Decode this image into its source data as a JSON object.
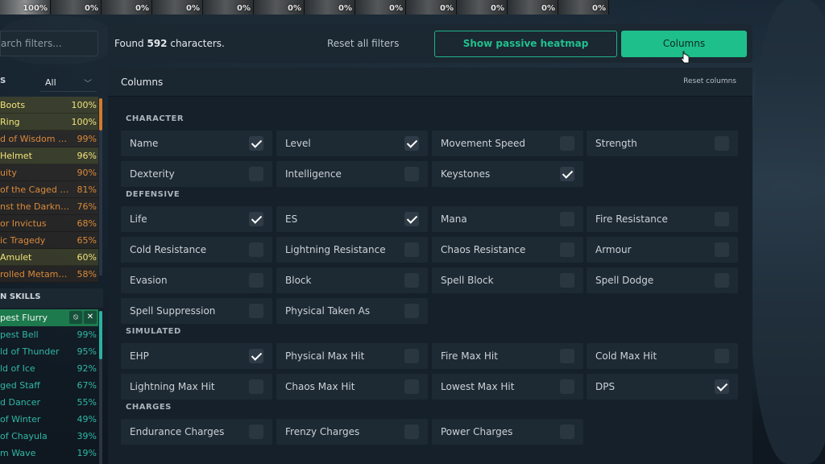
{
  "portraits": [
    "100%",
    "0%",
    "0%",
    "0%",
    "0%",
    "0%",
    "0%",
    "0%",
    "0%",
    "0%",
    "0%",
    "0%"
  ],
  "sidebar": {
    "search_placeholder": "arch filters...",
    "slot_label": "S",
    "slot_select": "All",
    "items": [
      {
        "name": "Boots",
        "pct": "100%",
        "color": "#f0e27a"
      },
      {
        "name": "Ring",
        "pct": "100%",
        "color": "#f0e27a"
      },
      {
        "name": "d of Wisdom and ...",
        "pct": "99%",
        "color": "#d98a3a"
      },
      {
        "name": "Helmet",
        "pct": "96%",
        "color": "#f0e27a"
      },
      {
        "name": "uity",
        "pct": "90%",
        "color": "#d98a3a"
      },
      {
        "name": "of the Caged God",
        "pct": "81%",
        "color": "#d98a3a"
      },
      {
        "name": "nst the Darkness",
        "pct": "76%",
        "color": "#d98a3a"
      },
      {
        "name": "or Invictus",
        "pct": "68%",
        "color": "#d98a3a"
      },
      {
        "name": "ic Tragedy",
        "pct": "65%",
        "color": "#d98a3a"
      },
      {
        "name": "Amulet",
        "pct": "60%",
        "color": "#f0e27a"
      },
      {
        "name": "rolled Metamorp...",
        "pct": "58%",
        "color": "#d98a3a"
      }
    ],
    "skills_heading": "N SKILLS",
    "skills": [
      {
        "name": "pest Flurry",
        "pct": "",
        "active": true
      },
      {
        "name": "pest Bell",
        "pct": "99%"
      },
      {
        "name": "ld of Thunder",
        "pct": "95%"
      },
      {
        "name": "ld of Ice",
        "pct": "92%"
      },
      {
        "name": "ged Staff",
        "pct": "67%"
      },
      {
        "name": "d Dancer",
        "pct": "55%"
      },
      {
        "name": "of Winter",
        "pct": "49%"
      },
      {
        "name": "of Chayula",
        "pct": "39%"
      },
      {
        "name": "m Wave",
        "pct": "19%"
      }
    ]
  },
  "topbar": {
    "found_prefix": "Found ",
    "found_count": "592",
    "found_suffix": " characters.",
    "reset_all": "Reset all filters",
    "heatmap_button": "Show passive heatmap",
    "columns_button": "Columns"
  },
  "panel": {
    "title": "Columns",
    "reset_columns": "Reset columns",
    "sections": [
      {
        "label": "CHARACTER",
        "options": [
          {
            "name": "Name",
            "checked": true
          },
          {
            "name": "Level",
            "checked": true
          },
          {
            "name": "Movement Speed",
            "checked": false
          },
          {
            "name": "Strength",
            "checked": false
          },
          {
            "name": "Dexterity",
            "checked": false
          },
          {
            "name": "Intelligence",
            "checked": false
          },
          {
            "name": "Keystones",
            "checked": true
          }
        ]
      },
      {
        "label": "DEFENSIVE",
        "options": [
          {
            "name": "Life",
            "checked": true
          },
          {
            "name": "ES",
            "checked": true
          },
          {
            "name": "Mana",
            "checked": false
          },
          {
            "name": "Fire Resistance",
            "checked": false
          },
          {
            "name": "Cold Resistance",
            "checked": false
          },
          {
            "name": "Lightning Resistance",
            "checked": false
          },
          {
            "name": "Chaos Resistance",
            "checked": false
          },
          {
            "name": "Armour",
            "checked": false
          },
          {
            "name": "Evasion",
            "checked": false
          },
          {
            "name": "Block",
            "checked": false
          },
          {
            "name": "Spell Block",
            "checked": false
          },
          {
            "name": "Spell Dodge",
            "checked": false
          },
          {
            "name": "Spell Suppression",
            "checked": false
          },
          {
            "name": "Physical Taken As",
            "checked": false
          }
        ]
      },
      {
        "label": "SIMULATED",
        "options": [
          {
            "name": "EHP",
            "checked": true
          },
          {
            "name": "Physical Max Hit",
            "checked": false
          },
          {
            "name": "Fire Max Hit",
            "checked": false
          },
          {
            "name": "Cold Max Hit",
            "checked": false
          },
          {
            "name": "Lightning Max Hit",
            "checked": false
          },
          {
            "name": "Chaos Max Hit",
            "checked": false
          },
          {
            "name": "Lowest Max Hit",
            "checked": false
          },
          {
            "name": "DPS",
            "checked": true
          }
        ]
      },
      {
        "label": "CHARGES",
        "options": [
          {
            "name": "Endurance Charges",
            "checked": false
          },
          {
            "name": "Frenzy Charges",
            "checked": false
          },
          {
            "name": "Power Charges",
            "checked": false
          }
        ]
      }
    ]
  }
}
